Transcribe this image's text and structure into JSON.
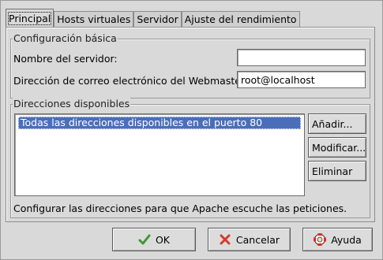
{
  "tabs": [
    {
      "label": "Principal"
    },
    {
      "label": "Hosts virtuales"
    },
    {
      "label": "Servidor"
    },
    {
      "label": "Ajuste del rendimiento"
    }
  ],
  "basic": {
    "title": "Configuración básica",
    "server_name_label": "Nombre del servidor:",
    "server_name_value": "",
    "email_label": "Dirección de correo electrónico del Webmaster:",
    "email_value": "root@localhost"
  },
  "addresses": {
    "title": "Direcciones disponibles",
    "items": [
      "Todas las direcciones disponibles en el puerto 80"
    ],
    "add_label": "Añadir...",
    "edit_label": "Modificar...",
    "delete_label": "Eliminar",
    "note": "Configurar las direcciones para que Apache escuche las peticiones."
  },
  "footer": {
    "ok_label": "OK",
    "cancel_label": "Cancelar",
    "help_label": "Ayuda"
  },
  "colors": {
    "selection": "#4a6fb8",
    "ok_icon": "#3b9a2f",
    "cancel_icon": "#d23b2b",
    "help_icon": "#c9341f"
  }
}
